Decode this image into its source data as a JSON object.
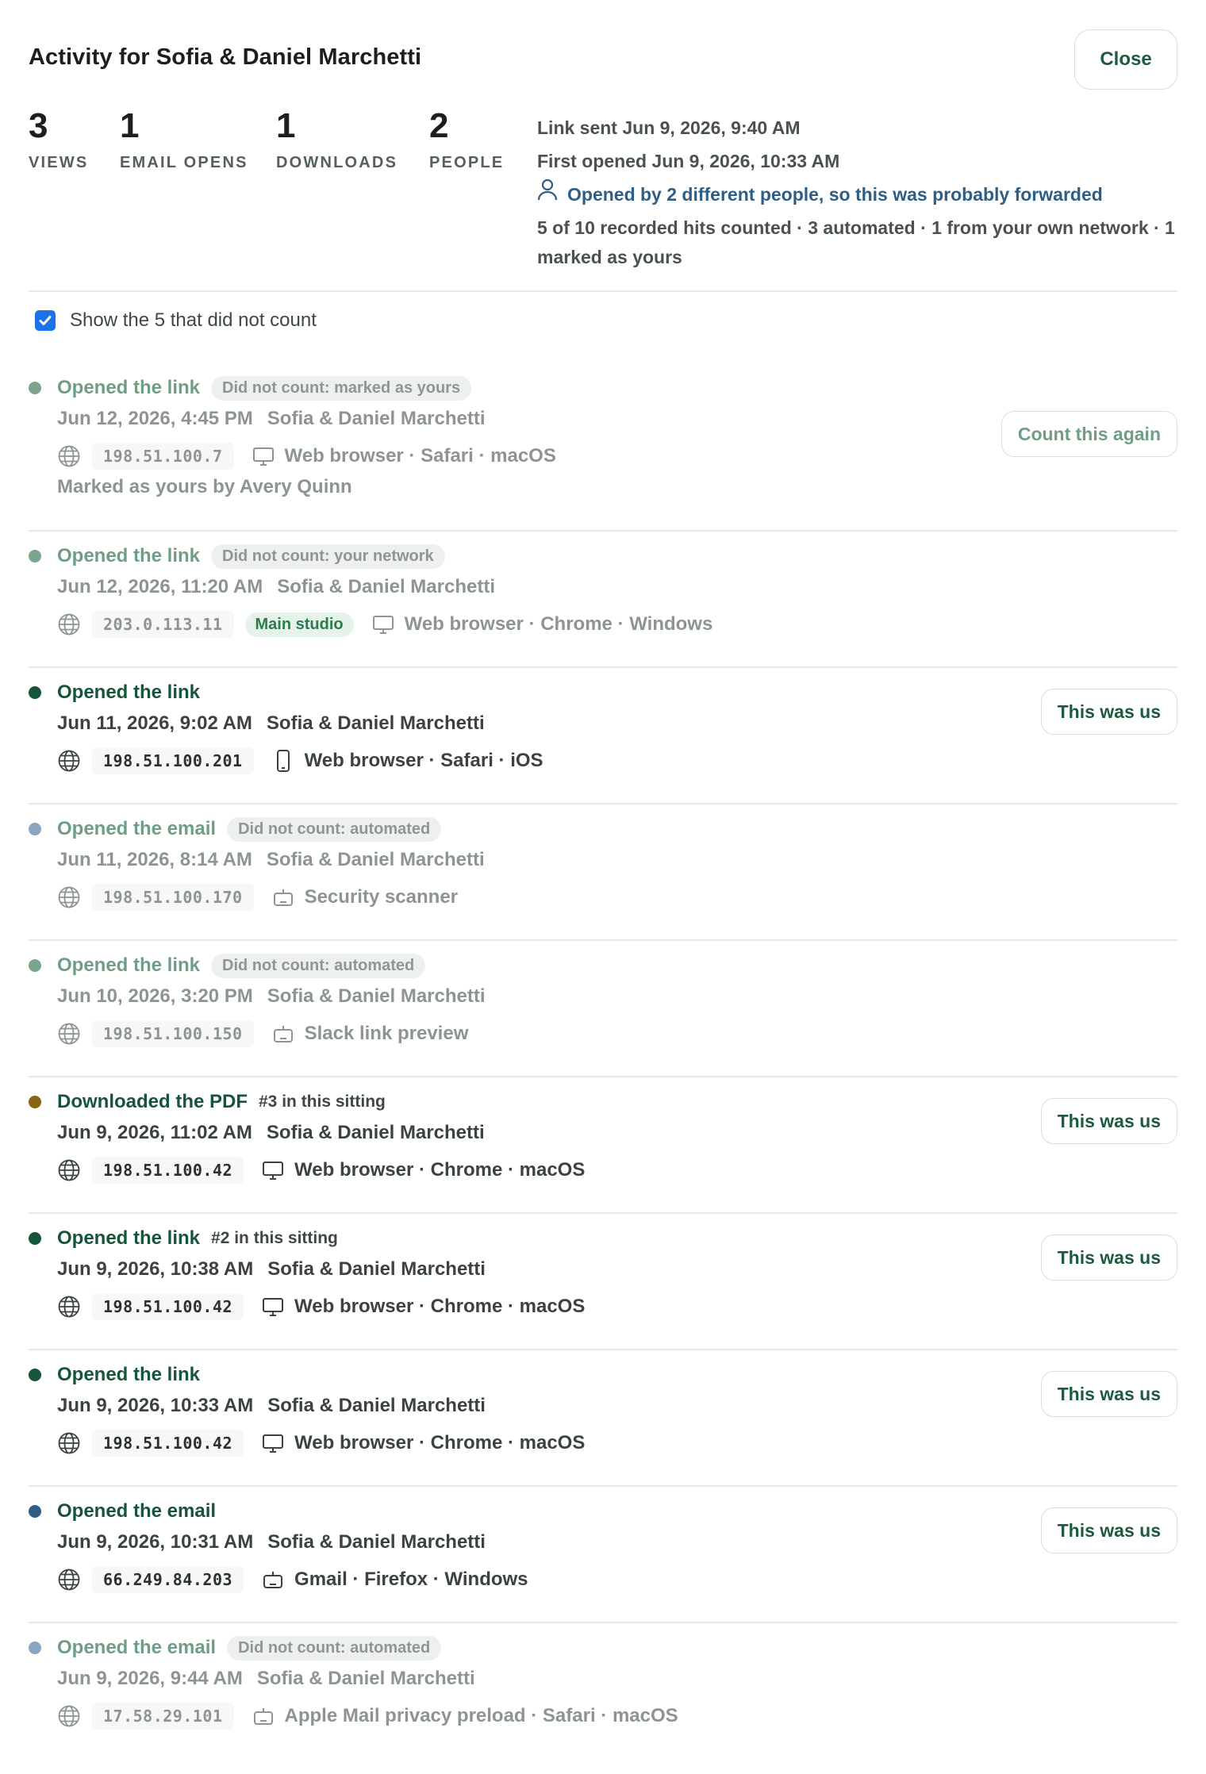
{
  "dialog": {
    "title": "Activity for Sofia & Daniel Marchetti",
    "close_label": "Close"
  },
  "stats": [
    {
      "value": "3",
      "label": "VIEWS"
    },
    {
      "value": "1",
      "label": "EMAIL OPENS"
    },
    {
      "value": "1",
      "label": "DOWNLOADS"
    },
    {
      "value": "2",
      "label": "PEOPLE"
    }
  ],
  "summary": {
    "link_sent": "Link sent Jun 9, 2026, 9:40 AM",
    "first_opened": "First opened Jun 9, 2026, 10:33 AM",
    "forwarded": "Opened by 2 different people, so this was probably forwarded",
    "counts": "5 of 10 recorded hits counted · 3 automated · 1 from your own network · 1 marked as yours"
  },
  "toggle": {
    "label": "Show the 5 that did not count",
    "checked": true
  },
  "events": [
    {
      "action": "Opened the link",
      "badge": "Did not count: marked as yours",
      "sitting": "",
      "date": "Jun 12, 2026, 4:45 PM",
      "person": "Sofia & Daniel Marchetti",
      "ip": "198.51.100.7",
      "location": "",
      "device_icon": "monitor-icon",
      "device": "Web browser",
      "detail": " · Safari · macOS",
      "note": "Marked as yours by Avery Quinn",
      "button": "Count this again",
      "counted": false,
      "dot_color": "#7ba68d"
    },
    {
      "action": "Opened the link",
      "badge": "Did not count: your network",
      "sitting": "",
      "date": "Jun 12, 2026, 11:20 AM",
      "person": "Sofia & Daniel Marchetti",
      "ip": "203.0.113.11",
      "location": "Main studio",
      "device_icon": "monitor-icon",
      "device": "Web browser",
      "detail": " · Chrome · Windows",
      "note": "",
      "button": "",
      "counted": false,
      "dot_color": "#7ba68d"
    },
    {
      "action": "Opened the link",
      "badge": "",
      "sitting": "",
      "date": "Jun 11, 2026, 9:02 AM",
      "person": "Sofia & Daniel Marchetti",
      "ip": "198.51.100.201",
      "location": "",
      "device_icon": "phone-icon",
      "device": "Web browser",
      "detail": " · Safari · iOS",
      "note": "",
      "button": "This was us",
      "counted": true,
      "dot_color": "#17553a"
    },
    {
      "action": "Opened the email",
      "badge": "Did not count: automated",
      "sitting": "",
      "date": "Jun 11, 2026, 8:14 AM",
      "person": "Sofia & Daniel Marchetti",
      "ip": "198.51.100.170",
      "location": "",
      "device_icon": "robot-icon",
      "device": "Security scanner",
      "detail": "",
      "note": "",
      "button": "",
      "counted": false,
      "dot_color": "#8aa5c2"
    },
    {
      "action": "Opened the link",
      "badge": "Did not count: automated",
      "sitting": "",
      "date": "Jun 10, 2026, 3:20 PM",
      "person": "Sofia & Daniel Marchetti",
      "ip": "198.51.100.150",
      "location": "",
      "device_icon": "robot-icon",
      "device": "Slack link preview",
      "detail": "",
      "note": "",
      "button": "",
      "counted": false,
      "dot_color": "#7ba68d"
    },
    {
      "action": "Downloaded the PDF",
      "badge": "",
      "sitting": "#3 in this sitting",
      "date": "Jun 9, 2026, 11:02 AM",
      "person": "Sofia & Daniel Marchetti",
      "ip": "198.51.100.42",
      "location": "",
      "device_icon": "monitor-icon",
      "device": "Web browser",
      "detail": " · Chrome · macOS",
      "note": "",
      "button": "This was us",
      "counted": true,
      "dot_color": "#8a6516"
    },
    {
      "action": "Opened the link",
      "badge": "",
      "sitting": "#2 in this sitting",
      "date": "Jun 9, 2026, 10:38 AM",
      "person": "Sofia & Daniel Marchetti",
      "ip": "198.51.100.42",
      "location": "",
      "device_icon": "monitor-icon",
      "device": "Web browser",
      "detail": " · Chrome · macOS",
      "note": "",
      "button": "This was us",
      "counted": true,
      "dot_color": "#17553a"
    },
    {
      "action": "Opened the link",
      "badge": "",
      "sitting": "",
      "date": "Jun 9, 2026, 10:33 AM",
      "person": "Sofia & Daniel Marchetti",
      "ip": "198.51.100.42",
      "location": "",
      "device_icon": "monitor-icon",
      "device": "Web browser",
      "detail": " · Chrome · macOS",
      "note": "",
      "button": "This was us",
      "counted": true,
      "dot_color": "#17553a"
    },
    {
      "action": "Opened the email",
      "badge": "",
      "sitting": "",
      "date": "Jun 9, 2026, 10:31 AM",
      "person": "Sofia & Daniel Marchetti",
      "ip": "66.249.84.203",
      "location": "",
      "device_icon": "robot-icon",
      "device": "Gmail",
      "detail": " · Firefox · Windows",
      "note": "",
      "button": "This was us",
      "counted": true,
      "dot_color": "#2e5e86"
    },
    {
      "action": "Opened the email",
      "badge": "Did not count: automated",
      "sitting": "",
      "date": "Jun 9, 2026, 9:44 AM",
      "person": "Sofia & Daniel Marchetti",
      "ip": "17.58.29.101",
      "location": "",
      "device_icon": "robot-icon",
      "device": "Apple Mail privacy preload",
      "detail": " · Safari · macOS",
      "note": "",
      "button": "",
      "counted": false,
      "dot_color": "#8aa5c2"
    }
  ]
}
